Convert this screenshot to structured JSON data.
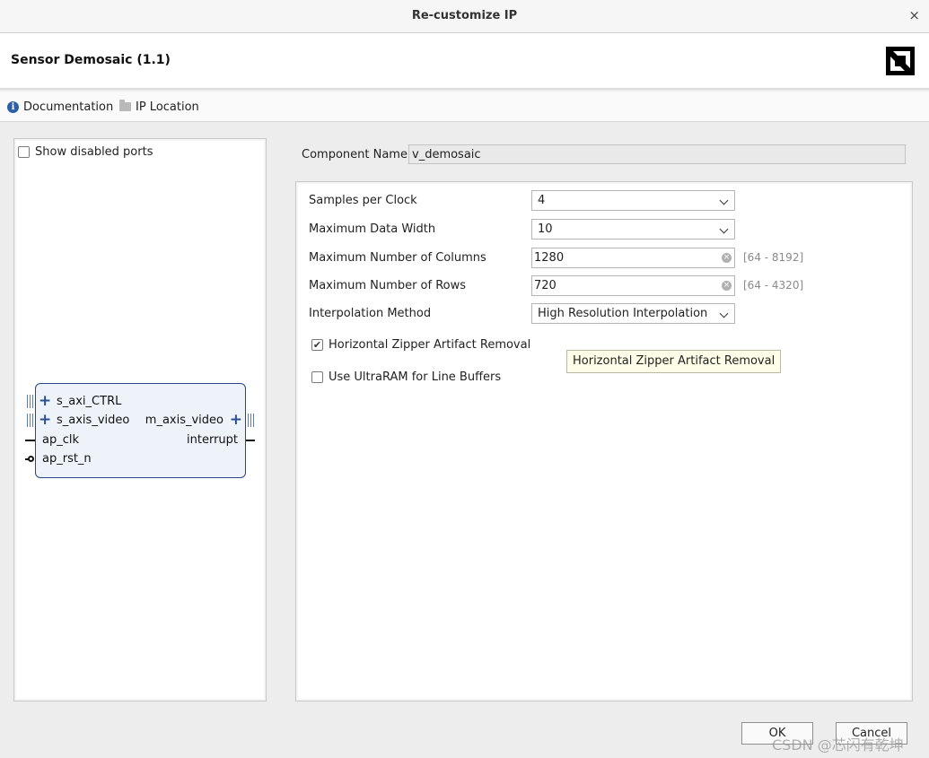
{
  "window": {
    "title": "Re-customize IP",
    "close_glyph": "×"
  },
  "header": {
    "ip_title": "Sensor Demosaic (1.1)",
    "logo_icon": "amd-logo-icon"
  },
  "toolbar": {
    "documentation_label": "Documentation",
    "ip_location_label": "IP Location"
  },
  "symbol_panel": {
    "show_disabled_ports_label": "Show disabled ports",
    "ports_left": [
      "s_axi_CTRL",
      "s_axis_video",
      "ap_clk",
      "ap_rst_n"
    ],
    "ports_right": [
      "m_axis_video",
      "interrupt"
    ]
  },
  "component": {
    "label": "Component Name",
    "value": "v_demosaic"
  },
  "params": {
    "samples_per_clock": {
      "label": "Samples per Clock",
      "value": "4"
    },
    "max_data_width": {
      "label": "Maximum Data Width",
      "value": "10"
    },
    "max_columns": {
      "label": "Maximum Number of Columns",
      "value": "1280",
      "range": "[64 - 8192]"
    },
    "max_rows": {
      "label": "Maximum Number of Rows",
      "value": "720",
      "range": "[64 - 4320]"
    },
    "interpolation": {
      "label": "Interpolation Method",
      "value": "High Resolution Interpolation"
    },
    "zipper_removal": {
      "label": "Horizontal Zipper Artifact Removal",
      "checked": true
    },
    "ultraram": {
      "label": "Use UltraRAM for Line Buffers",
      "checked": false
    }
  },
  "tooltip": {
    "text": "Horizontal Zipper Artifact Removal"
  },
  "buttons": {
    "ok": "OK",
    "cancel": "Cancel"
  },
  "watermark": "CSDN @芯闪有乾坤"
}
